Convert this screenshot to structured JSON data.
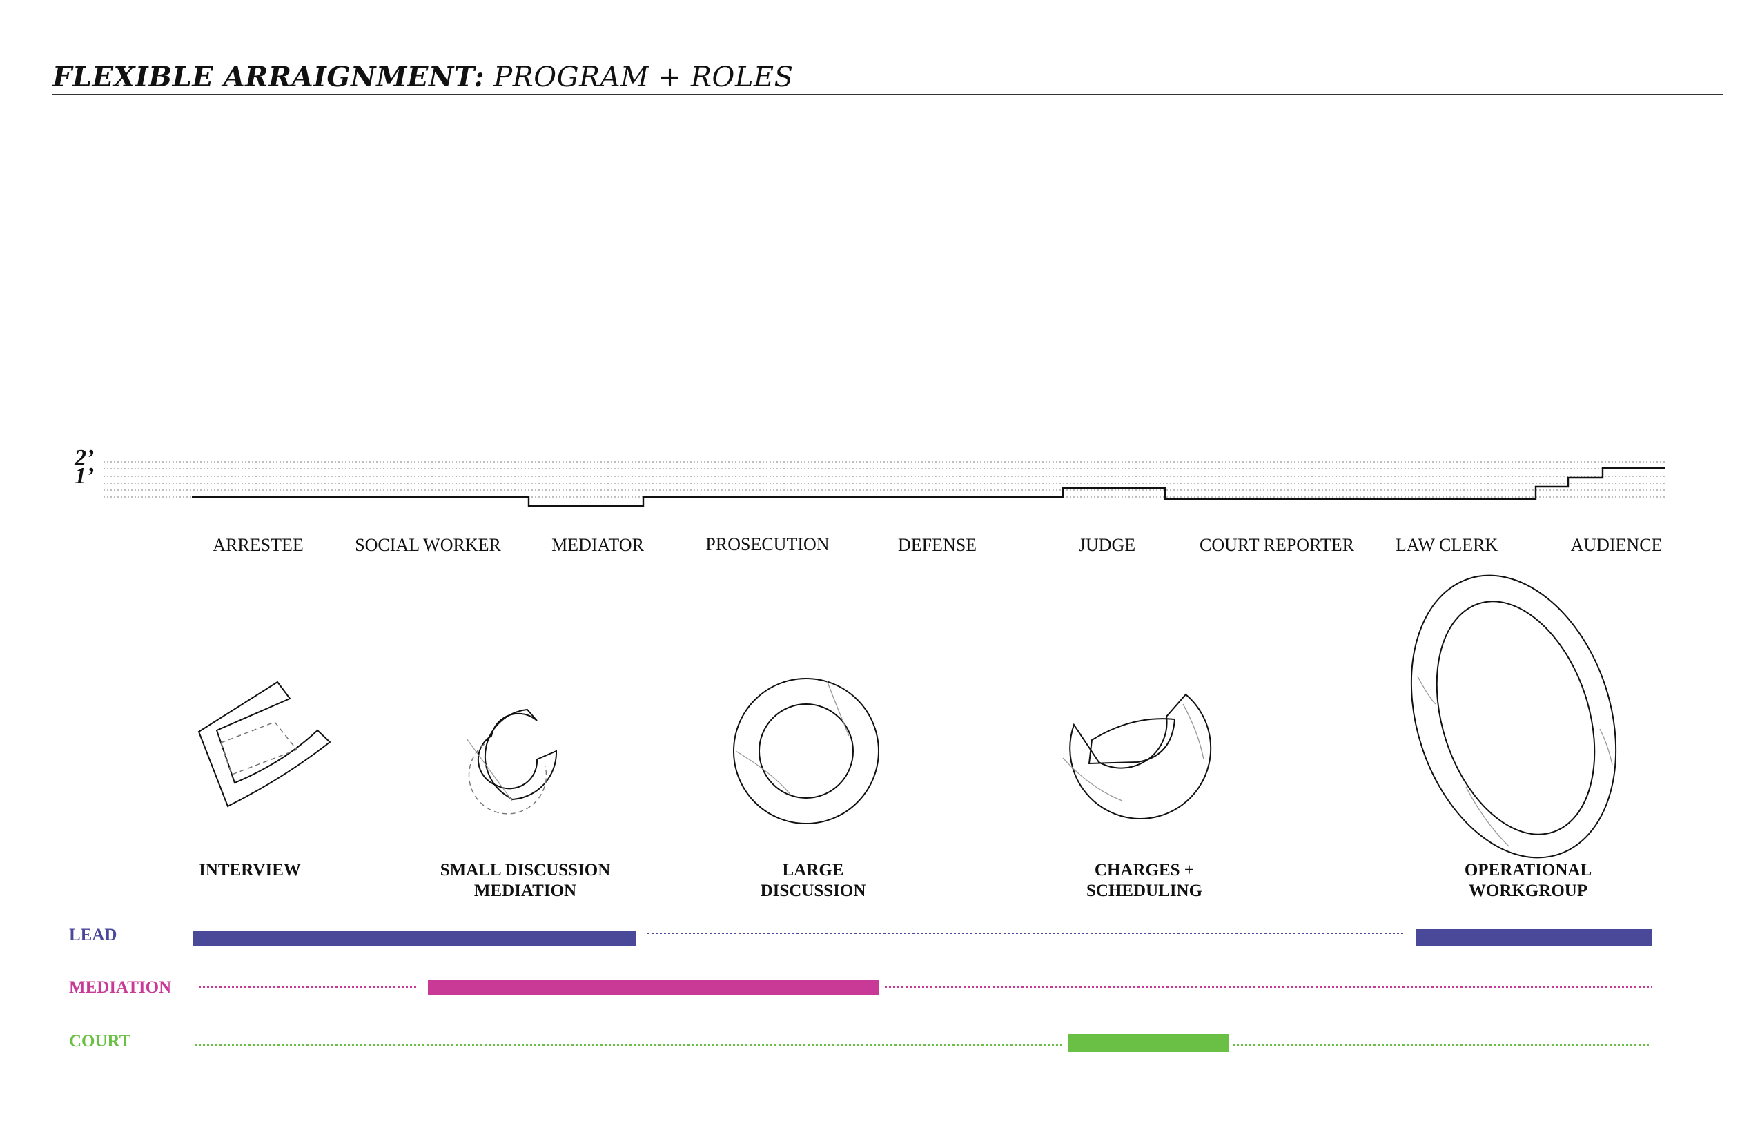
{
  "title": {
    "bold": "FLEXIBLE ARRAIGNMENT:",
    "regular": " PROGRAM + ROLES"
  },
  "scale": {
    "two": "2’",
    "one": "1’"
  },
  "roles": [
    "ARRESTEE",
    "SOCIAL WORKER",
    "MEDIATOR",
    "PROSECUTION",
    "DEFENSE",
    "JUDGE",
    "COURT REPORTER",
    "LAW CLERK",
    "AUDIENCE"
  ],
  "programs": [
    {
      "line1": "INTERVIEW",
      "line2": ""
    },
    {
      "line1": "SMALL DISCUSSION",
      "line2": "MEDIATION"
    },
    {
      "line1": "LARGE",
      "line2": "DISCUSSION"
    },
    {
      "line1": "CHARGES +",
      "line2": "SCHEDULING"
    },
    {
      "line1": "OPERATIONAL",
      "line2": "WORKGROUP"
    }
  ],
  "categories": {
    "lead": {
      "label": "LEAD",
      "color": "#4a4898"
    },
    "mediation": {
      "label": "MEDIATION",
      "color": "#c83a95"
    },
    "court": {
      "label": "COURT",
      "color": "#6abf45"
    }
  }
}
